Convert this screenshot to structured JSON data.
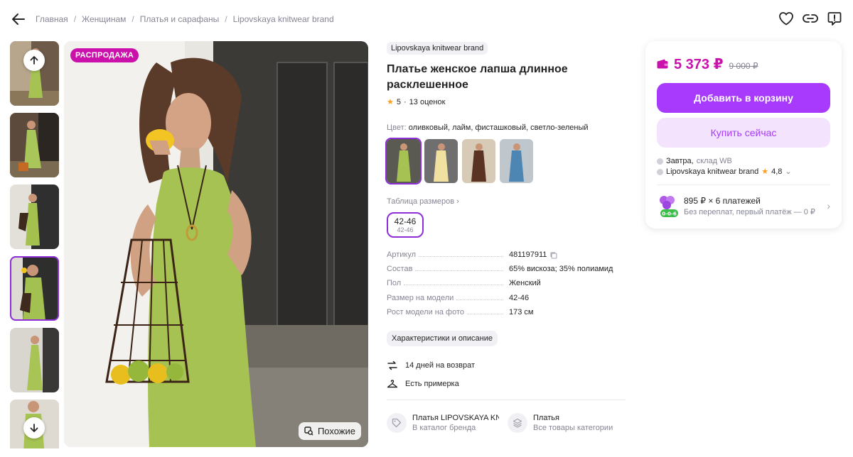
{
  "breadcrumb": [
    "Главная",
    "Женщинам",
    "Платья и сарафаны",
    "Lipovskaya knitwear brand"
  ],
  "photo": {
    "badge": "РАСПРОДАЖА",
    "similar_label": "Похожие"
  },
  "product": {
    "brand": "Lipovskaya knitwear brand",
    "title": "Платье женское лапша длинное расклешенное",
    "rating": "5",
    "reviews": "13 оценок",
    "color_label": "Цвет:",
    "color_value": "оливковый, лайм, фисташковый, светло-зеленый",
    "size_table": "Таблица размеров",
    "size_main": "42-46",
    "size_sub": "42-46"
  },
  "specs": [
    {
      "key": "Артикул",
      "value": "481197911"
    },
    {
      "key": "Состав",
      "value": "65% вискоза; 35% полиамид"
    },
    {
      "key": "Пол",
      "value": "Женский"
    },
    {
      "key": "Размер на модели",
      "value": "42-46"
    },
    {
      "key": "Рост модели на фото",
      "value": "173 см"
    }
  ],
  "chars_button": "Характеристики и описание",
  "features": {
    "return": "14 дней на возврат",
    "fitting": "Есть примерка"
  },
  "categories": [
    {
      "title": "Платья LIPOVSKAYA KNITWEAR",
      "sub": "В каталог бренда"
    },
    {
      "title": "Платья",
      "sub": "Все товары категории"
    }
  ],
  "buy": {
    "price": "5 373 ₽",
    "old_price": "9 000 ₽",
    "cart_button": "Добавить в корзину",
    "buy_now": "Купить сейчас",
    "delivery": "Завтра,",
    "warehouse": "склад WB",
    "seller": "Lipovskaya knitwear brand",
    "seller_rating": "4,8",
    "installment": "895 ₽ × 6 платежей",
    "installment_note": "Без переплат, первый платёж — 0 ₽",
    "installment_badge": "0-0-6"
  },
  "colors": {
    "accent": "#a73afd",
    "price": "#cb11ab",
    "outline": "#8d2ed9"
  }
}
